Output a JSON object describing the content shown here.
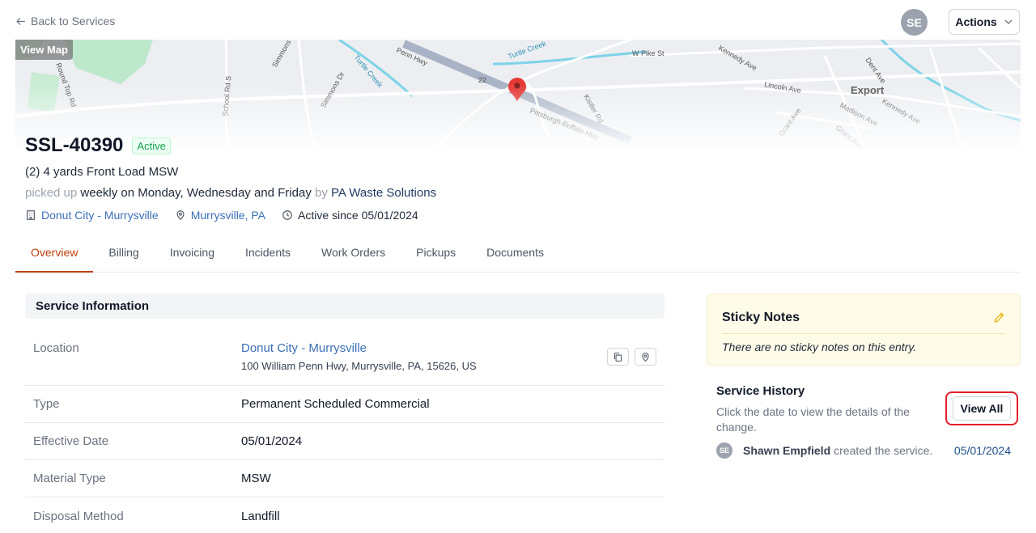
{
  "nav": {
    "back_label": "Back to Services"
  },
  "header": {
    "avatar_initials": "SE",
    "actions_label": "Actions"
  },
  "map": {
    "view_map_label": "View Map",
    "labels": [
      "Penn Hwy",
      "Turtle Creek",
      "Turtle Creek",
      "W Pike St",
      "Kennedy Ave",
      "Dent Ave",
      "Lincoln Ave",
      "Export",
      "Madison Ave",
      "Kennedy Ave",
      "Simmons Dr",
      "Simmons Dr",
      "School Rd S",
      "Kistler Rd",
      "Pittsburgh-Buffalo Hwy",
      "Grant Ave",
      "Grant Ave",
      "22",
      "Round Top Rd"
    ]
  },
  "service": {
    "id": "SSL-40390",
    "status": "Active",
    "description": "(2) 4 yards Front Load MSW",
    "schedule_prefix": "picked up",
    "schedule": "weekly on Monday, Wednesday and Friday",
    "schedule_by": "by",
    "vendor": "PA Waste Solutions",
    "location_link": "Donut City - Murrysville",
    "city_link": "Murrysville, PA",
    "active_since": "Active since 05/01/2024"
  },
  "tabs": [
    "Overview",
    "Billing",
    "Invoicing",
    "Incidents",
    "Work Orders",
    "Pickups",
    "Documents"
  ],
  "service_info": {
    "header": "Service Information",
    "location_label": "Location",
    "location_name": "Donut City - Murrysville",
    "location_address": "100 William Penn Hwy, Murrysville, PA, 15626, US",
    "rows": [
      {
        "label": "Type",
        "value": "Permanent Scheduled Commercial"
      },
      {
        "label": "Effective Date",
        "value": "05/01/2024"
      },
      {
        "label": "Material Type",
        "value": "MSW"
      },
      {
        "label": "Disposal Method",
        "value": "Landfill"
      }
    ]
  },
  "sticky_notes": {
    "title": "Sticky Notes",
    "empty_text": "There are no sticky notes on this entry."
  },
  "history": {
    "title": "Service History",
    "description": "Click the date to view the details of the change.",
    "view_all_label": "View All",
    "entry": {
      "avatar": "SE",
      "user": "Shawn Empfield",
      "action": "created the service.",
      "date": "05/01/2024"
    }
  },
  "colors": {
    "accent_tab": "#c2410c",
    "link": "#3b6fb6",
    "active_badge": "#16a34a",
    "highlight_ring": "#e11d2a"
  }
}
